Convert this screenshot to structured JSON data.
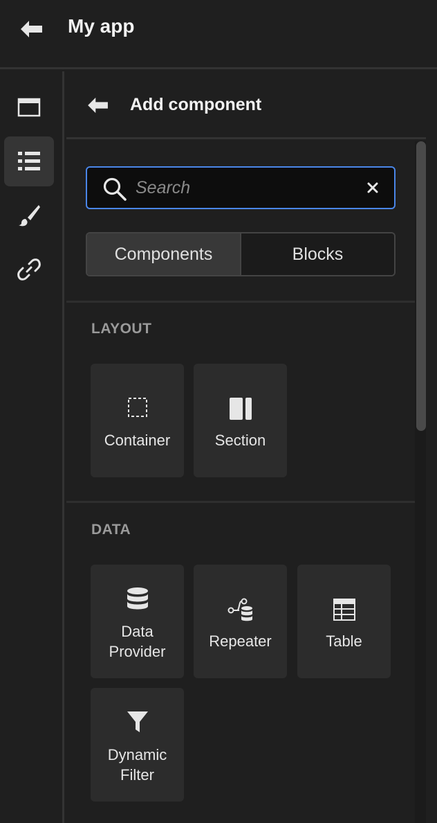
{
  "app": {
    "title": "My app"
  },
  "rail": {
    "items": [
      {
        "name": "screen-icon",
        "active": false
      },
      {
        "name": "components-list-icon",
        "active": true
      },
      {
        "name": "paintbrush-icon",
        "active": false
      },
      {
        "name": "link-icon",
        "active": false
      }
    ]
  },
  "panel": {
    "title": "Add component",
    "search": {
      "placeholder": "Search",
      "value": ""
    },
    "segments": {
      "components": "Components",
      "blocks": "Blocks",
      "selected": "Components"
    },
    "sections": {
      "layout": {
        "label": "LAYOUT",
        "items": [
          {
            "label": "Container",
            "icon": "dashed-square-icon"
          },
          {
            "label": "Section",
            "icon": "columns-icon"
          }
        ]
      },
      "data": {
        "label": "DATA",
        "items": [
          {
            "label": "Data\nProvider",
            "icon": "database-icon"
          },
          {
            "label": "Repeater",
            "icon": "repeater-icon"
          },
          {
            "label": "Table",
            "icon": "table-icon"
          },
          {
            "label": "Dynamic\nFilter",
            "icon": "filter-icon"
          }
        ]
      }
    }
  },
  "colors": {
    "accent": "#4a86e8",
    "background": "#1f1f1f",
    "tile": "#2c2c2c"
  }
}
